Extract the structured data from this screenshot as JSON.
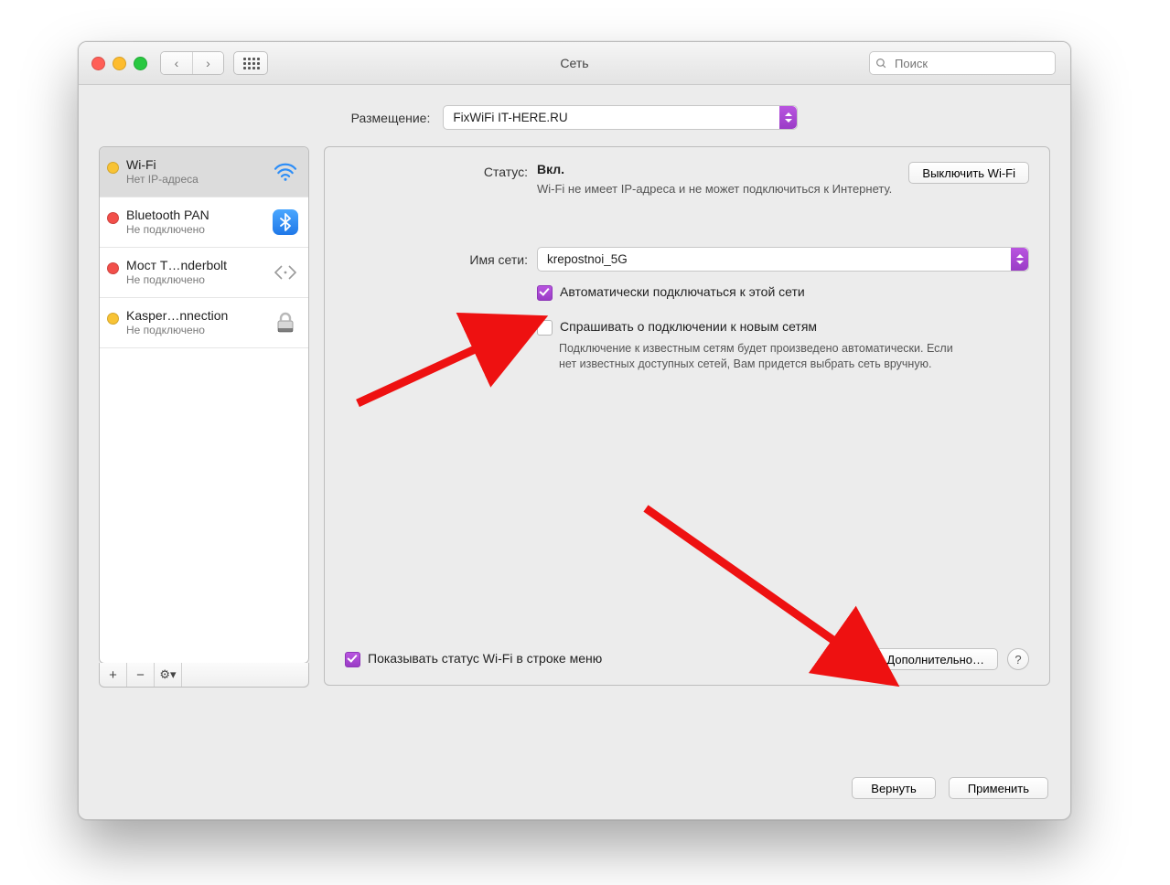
{
  "window": {
    "title": "Сеть"
  },
  "search": {
    "placeholder": "Поиск"
  },
  "location": {
    "label": "Размещение:",
    "value": "FixWiFi IT-HERE.RU"
  },
  "sidebar": {
    "items": [
      {
        "name": "Wi-Fi",
        "sub": "Нет IP-адреса",
        "status": "yellow",
        "icon": "wifi",
        "selected": true
      },
      {
        "name": "Bluetooth PAN",
        "sub": "Не подключено",
        "status": "red",
        "icon": "bluetooth",
        "selected": false
      },
      {
        "name": "Мост T…nderbolt",
        "sub": "Не подключено",
        "status": "red",
        "icon": "thunderbolt",
        "selected": false
      },
      {
        "name": "Kasper…nnection",
        "sub": "Не подключено",
        "status": "yellow",
        "icon": "lock",
        "selected": false
      }
    ]
  },
  "main": {
    "status_label": "Статус:",
    "status_value": "Вкл.",
    "status_sub": "Wi-Fi не имеет IP-адреса и не может подключиться к Интернету.",
    "wifi_off_btn": "Выключить Wi-Fi",
    "network_label": "Имя сети:",
    "network_value": "krepostnoi_5G",
    "auto_join": {
      "checked": true,
      "label": "Автоматически подключаться к этой сети"
    },
    "ask_join": {
      "checked": false,
      "label": "Спрашивать о подключении к новым сетям",
      "desc": "Подключение к известным сетям будет произведено автоматически. Если нет известных доступных сетей, Вам придется выбрать сеть вручную."
    },
    "show_status": {
      "checked": true,
      "label": "Показывать статус Wi-Fi в строке меню"
    },
    "advanced_btn": "Дополнительно…",
    "help_btn": "?"
  },
  "footer": {
    "revert": "Вернуть",
    "apply": "Применить"
  }
}
